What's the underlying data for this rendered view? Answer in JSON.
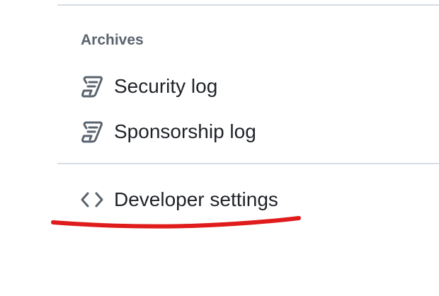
{
  "archives": {
    "heading": "Archives",
    "items": [
      {
        "label": "Security log",
        "icon": "log-icon"
      },
      {
        "label": "Sponsorship log",
        "icon": "log-icon"
      }
    ]
  },
  "developer": {
    "label": "Developer settings",
    "icon": "code-icon"
  },
  "colors": {
    "divider": "#d8dee4",
    "heading": "#59636e",
    "text": "#1f2328",
    "annotation": "#e01b1b"
  }
}
